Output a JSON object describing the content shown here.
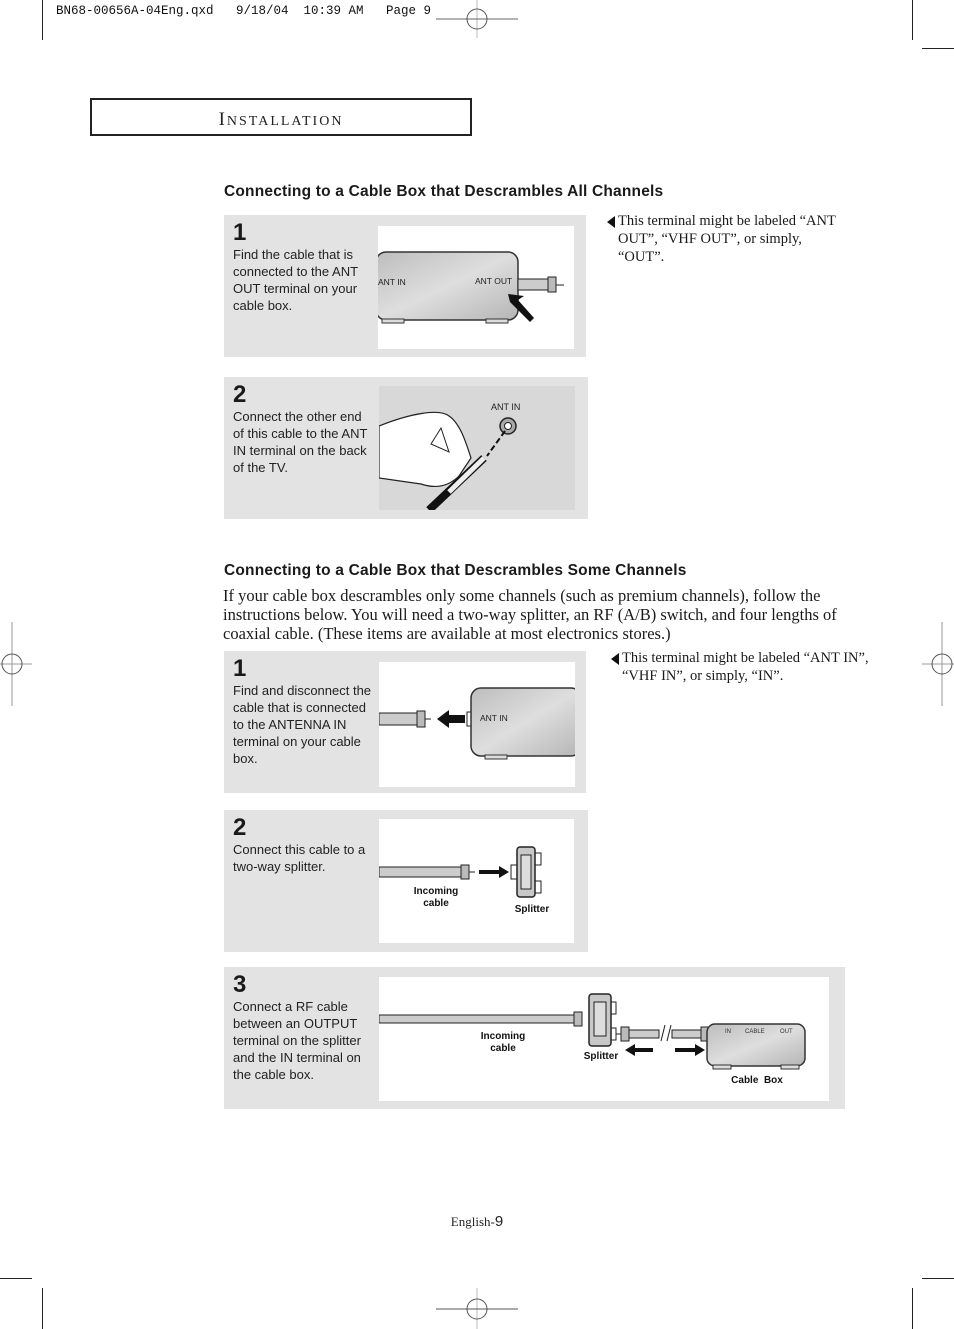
{
  "slug": "BN68-00656A-04Eng.qxd   9/18/04  10:39 AM   Page 9",
  "section": {
    "first_letter": "I",
    "rest": "NSTALLATION"
  },
  "part1": {
    "heading": "Connecting to a Cable Box that Descrambles All Channels",
    "steps": [
      {
        "number": "1",
        "text": "Find the cable that is connected to the ANT OUT terminal on your cable box.",
        "labels": {
          "ant_in": "ANT IN",
          "ant_out": "ANT OUT"
        }
      },
      {
        "number": "2",
        "text": "Connect the other end of this cable to the ANT IN terminal on the back of the TV.",
        "labels": {
          "ant_in": "ANT IN"
        }
      }
    ],
    "note": "This terminal might be labeled “ANT OUT”, “VHF OUT”, or simply, “OUT”."
  },
  "part2": {
    "heading": "Connecting to a Cable Box that Descrambles Some Channels",
    "intro": "If your cable box descrambles only some channels (such as premium channels), follow the instructions below. You will need a two-way splitter, an RF (A/B) switch, and four lengths of coaxial cable. (These items are available at most electronics stores.)",
    "steps": [
      {
        "number": "1",
        "text": "Find and disconnect the cable that is connected to the ANTENNA IN terminal on your cable box.",
        "labels": {
          "ant_in": "ANT IN"
        }
      },
      {
        "number": "2",
        "text": "Connect this cable to a two-way splitter.",
        "labels": {
          "incoming1": "Incoming",
          "incoming2": "cable",
          "splitter": "Splitter"
        }
      },
      {
        "number": "3",
        "text": "Connect a RF cable between an OUTPUT terminal on the splitter and the IN terminal on the cable box.",
        "labels": {
          "incoming1": "Incoming",
          "incoming2": "cable",
          "splitter": "Splitter",
          "box_in": "IN",
          "box_cable": "CABLE",
          "box_out": "OUT",
          "cable_box": "Cable  Box"
        }
      }
    ],
    "note": "This terminal might be labeled “ANT IN”, “VHF IN”, or simply, “IN”."
  },
  "footer": {
    "prefix": "English-",
    "page": "9"
  }
}
